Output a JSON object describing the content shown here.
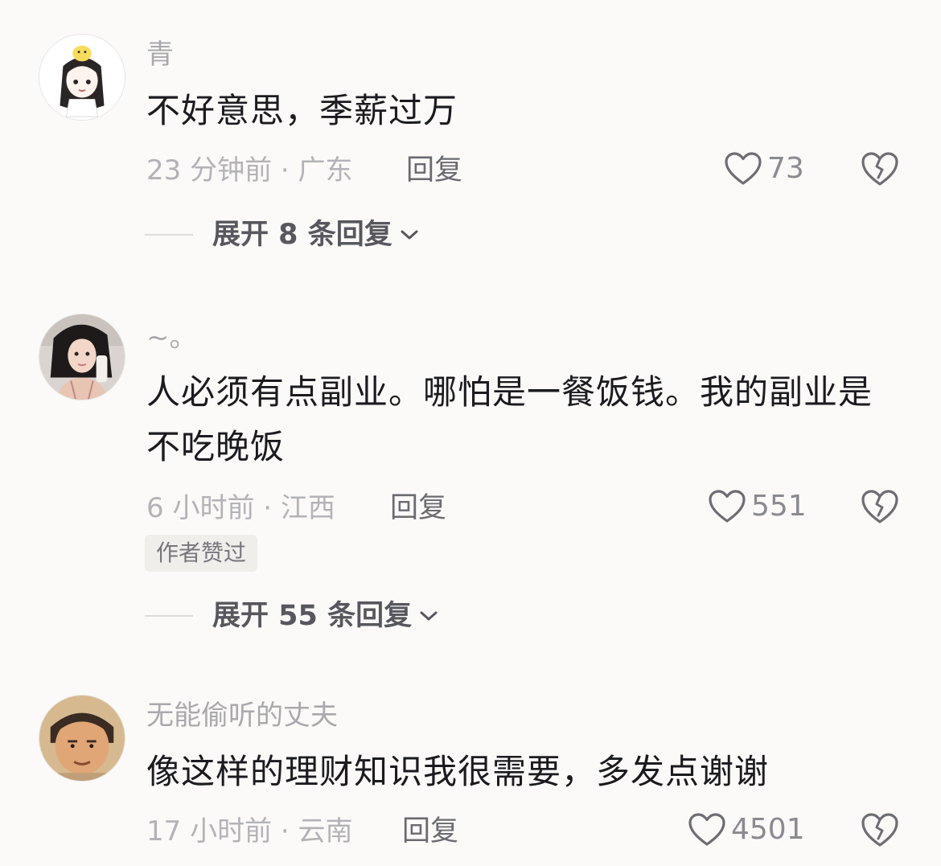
{
  "comments": [
    {
      "username": "青",
      "text": "不好意思，季薪过万",
      "meta": "23 分钟前 · 广东",
      "reply_label": "回复",
      "likes": "73",
      "avatar_icon": "anime-girl-avatar-icon",
      "expand_label": "展开 8 条回复"
    },
    {
      "username": "~。",
      "text": "人必须有点副业。哪怕是一餐饭钱。我的副业是不吃晚饭",
      "meta": "6 小时前 · 江西",
      "reply_label": "回复",
      "likes": "551",
      "avatar_icon": "woman-photo-avatar-icon",
      "badge": "作者赞过",
      "expand_label": "展开 55 条回复"
    },
    {
      "username": "无能偷听的丈夫",
      "text": "像这样的理财知识我很需要，多发点谢谢",
      "meta": "17 小时前 · 云南",
      "reply_label": "回复",
      "likes": "4501",
      "avatar_icon": "man-photo-avatar-icon"
    }
  ],
  "icons": {
    "like": "heart-outline-icon",
    "dislike": "broken-heart-icon",
    "expand": "chevron-down-icon"
  },
  "colors": {
    "background": "#fbfaf8",
    "text_primary": "#1b1b1f",
    "text_secondary": "#a9a9ad",
    "icon_gray": "#6d6d72"
  }
}
